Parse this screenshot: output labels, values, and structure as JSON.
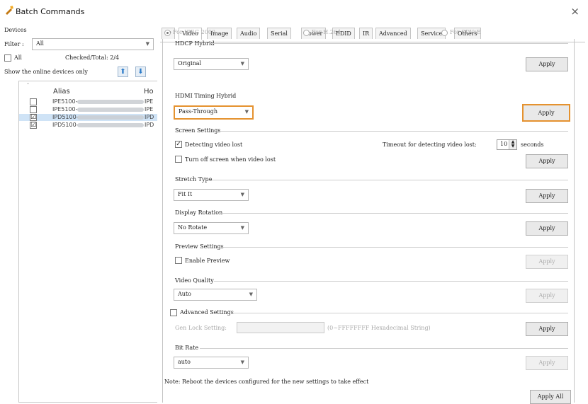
{
  "window": {
    "title": "Batch Commands",
    "close_glyph": "×"
  },
  "left": {
    "devices_label": "Devices",
    "filter_label": "Filter :",
    "filter_value": "All",
    "all_label": "All",
    "checked_total": "Checked/Total: 2/4",
    "online_only": "Show the online devices only",
    "up_glyph": "⬆",
    "down_glyph": "⬇",
    "columns": {
      "alias": "Alias",
      "host": "Ho"
    },
    "devices": [
      {
        "alias": "IPE5100-",
        "host": "IPE",
        "checked": "",
        "selected": false
      },
      {
        "alias": "IPE5100-",
        "host": "IPE",
        "checked": "",
        "selected": false
      },
      {
        "alias": "IPD5100-",
        "host": "IPD",
        "checked": "☑",
        "selected": true
      },
      {
        "alias": "IPD5100-",
        "host": "IPD",
        "checked": "☑",
        "selected": false
      }
    ]
  },
  "tabs": [
    "IP",
    "Video",
    "Image",
    "Audio",
    "Serial",
    "Power",
    "EDID",
    "IR",
    "Advanced",
    "Service",
    "Others"
  ],
  "active_tab": "Video",
  "video": {
    "radios": [
      "For JPEG 2000",
      "For H.264",
      "For SDVoE"
    ],
    "hdcp": {
      "title": "HDCP Hybrid",
      "value": "Original",
      "apply": "Apply"
    },
    "hdmi_timing": {
      "title": "HDMI Timing Hybrid",
      "value": "Pass-Through",
      "apply": "Apply"
    },
    "screen": {
      "title": "Screen Settings",
      "detect_label": "Detecting video lost",
      "timeout_label": "Timeout for detecting video lost:",
      "timeout_value": "10",
      "seconds": "seconds",
      "turnoff_label": "Turn off screen when video lost",
      "apply": "Apply"
    },
    "stretch": {
      "title": "Stretch Type",
      "value": "Fit It",
      "apply": "Apply"
    },
    "rotation": {
      "title": "Display Rotation",
      "value": "No Rotate",
      "apply": "Apply"
    },
    "preview": {
      "title": "Preview Settings",
      "enable_label": "Enable Preview",
      "apply": "Apply"
    },
    "quality": {
      "title": "Video Quality",
      "value": "Auto",
      "apply": "Apply"
    },
    "advanced": {
      "title": "Advanced Settings",
      "genlock_label": "Gen Lock Setting:",
      "hint": "(0~FFFFFFFF Hexadecimal String)",
      "apply": "Apply"
    },
    "bitrate": {
      "title": "Bit Rate",
      "value": "auto",
      "apply": "Apply"
    },
    "note": "Note: Reboot the devices configured for the new settings to take effect",
    "apply_all": "Apply All"
  },
  "icons": {
    "app": "batch-icon",
    "close": "close-icon",
    "dropdown": "chevron-down-icon",
    "up": "arrow-up-icon",
    "down": "arrow-down-icon"
  },
  "colors": {
    "highlight": "#e5922f",
    "selected_row": "#cfe3f6",
    "arrow_blue": "#2b7bc9"
  }
}
